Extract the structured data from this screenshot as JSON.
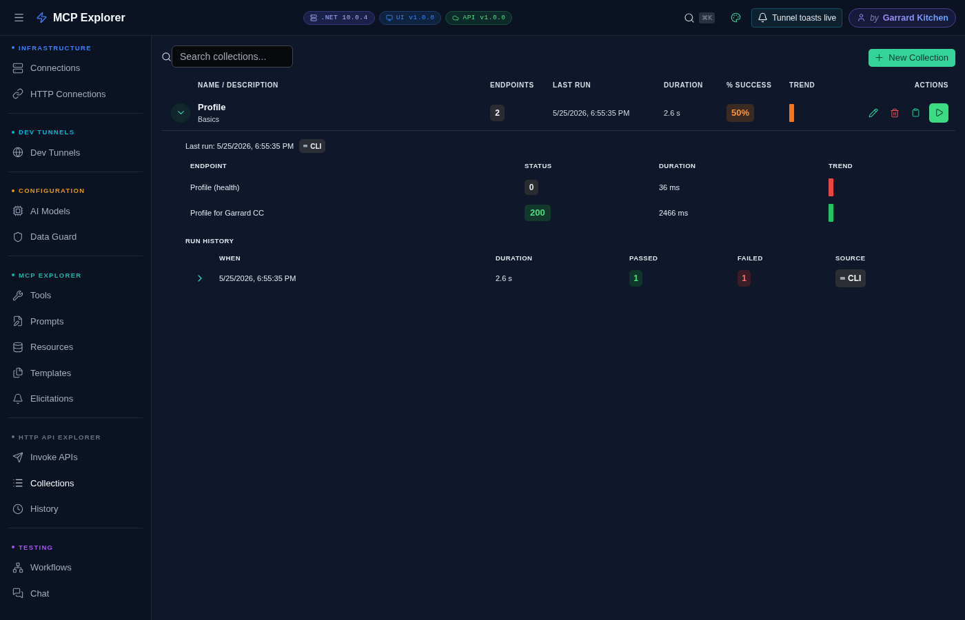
{
  "app": {
    "title": "MCP Explorer"
  },
  "version_badges": [
    {
      "label": ".NET 10.0.4",
      "kind": "runtime"
    },
    {
      "label": "UI v1.0.0",
      "kind": "ui"
    },
    {
      "label": "API v1.0.0",
      "kind": "api"
    }
  ],
  "toolbar": {
    "shortcut": "⌘K",
    "toasts_button": "Tunnel toasts live",
    "user": {
      "prefix": "by",
      "name": "Garrard Kitchen"
    }
  },
  "sidebar": {
    "sections": [
      {
        "title": "INFRASTRUCTURE",
        "color": "#3b82f6",
        "items": [
          {
            "label": "Connections",
            "selected": false
          },
          {
            "label": "HTTP Connections",
            "selected": false
          }
        ]
      },
      {
        "title": "DEV TUNNELS",
        "color": "#06b6d4",
        "items": [
          {
            "label": "Dev Tunnels",
            "selected": false
          }
        ]
      },
      {
        "title": "CONFIGURATION",
        "color": "#e0961a",
        "items": [
          {
            "label": "AI Models",
            "selected": false
          },
          {
            "label": "Data Guard",
            "selected": false
          }
        ]
      },
      {
        "title": "MCP EXPLORER",
        "color": "#14b8a6",
        "items": [
          {
            "label": "Tools",
            "selected": false
          },
          {
            "label": "Prompts",
            "selected": false
          },
          {
            "label": "Resources",
            "selected": false
          },
          {
            "label": "Templates",
            "selected": false
          },
          {
            "label": "Elicitations",
            "selected": false
          }
        ]
      },
      {
        "title": "HTTP API EXPLORER",
        "color": "#6b7280",
        "items": [
          {
            "label": "Invoke APIs",
            "selected": false
          },
          {
            "label": "Collections",
            "selected": true
          },
          {
            "label": "History",
            "selected": false
          }
        ]
      },
      {
        "title": "TESTING",
        "color": "#a855f7",
        "items": [
          {
            "label": "Workflows",
            "selected": false
          },
          {
            "label": "Chat",
            "selected": false
          }
        ]
      }
    ]
  },
  "collections": {
    "search": {
      "placeholder": "Search collections..."
    },
    "new_button": "New Collection",
    "columns": [
      "NAME / DESCRIPTION",
      "ENDPOINTS",
      "LAST RUN",
      "DURATION",
      "% SUCCESS",
      "TREND",
      "ACTIONS"
    ],
    "rows": [
      {
        "name": "Profile",
        "description": "Basics",
        "endpoints": "2",
        "last_run": "5/25/2026, 6:55:35 PM",
        "duration": "2.6 s",
        "success": {
          "text": "50%",
          "kind": "warning"
        },
        "trend": {
          "color": "#f97316"
        },
        "expanded": true,
        "details": {
          "last_run": "Last run: 5/25/2026, 6:55:35 PM",
          "source": "CLI",
          "endpoint_columns": [
            "ENDPOINT",
            "STATUS",
            "DURATION",
            "TREND"
          ],
          "endpoints": [
            {
              "name": "Profile (health)",
              "status": {
                "text": "0",
                "kind": "neutral"
              },
              "duration": "36 ms",
              "trend": {
                "color": "#ef4444"
              }
            },
            {
              "name": "Profile for Garrard CC",
              "status": {
                "text": "200",
                "kind": "success"
              },
              "duration": "2466 ms",
              "trend": {
                "color": "#22c55e"
              }
            }
          ],
          "history_title": "RUN HISTORY",
          "history_columns": [
            "WHEN",
            "DURATION",
            "PASSED",
            "FAILED",
            "SOURCE"
          ],
          "history": [
            {
              "when": "5/25/2026, 6:55:35 PM",
              "duration": "2.6 s",
              "passed": "1",
              "failed": "1",
              "source": "CLI",
              "expanded": false
            }
          ]
        }
      }
    ]
  }
}
